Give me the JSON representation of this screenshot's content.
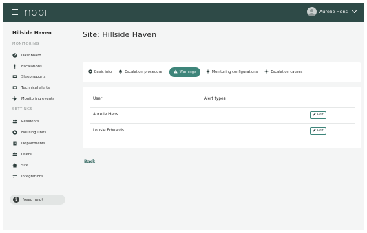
{
  "header": {
    "logo": "nobi",
    "user_name": "Aurelie Hens"
  },
  "sidebar": {
    "site_name": "Hillside Haven",
    "monitoring_label": "MONITORING",
    "settings_label": "SETTINGS",
    "monitoring_items": [
      {
        "label": "Dashboard",
        "icon": "gauge-icon"
      },
      {
        "label": "Escalations",
        "icon": "escalation-icon"
      },
      {
        "label": "Sleep reports",
        "icon": "bed-icon"
      },
      {
        "label": "Technical alerts",
        "icon": "device-icon"
      },
      {
        "label": "Monitoring events",
        "icon": "lamp-icon"
      }
    ],
    "settings_items": [
      {
        "label": "Residents",
        "icon": "residents-icon"
      },
      {
        "label": "Housing units",
        "icon": "housing-icon"
      },
      {
        "label": "Departments",
        "icon": "building-icon"
      },
      {
        "label": "Users",
        "icon": "users-icon"
      },
      {
        "label": "Site",
        "icon": "home-icon"
      },
      {
        "label": "Integrations",
        "icon": "integrations-icon"
      }
    ],
    "help_label": "Need help?"
  },
  "main": {
    "title": "Site: Hillside Haven",
    "tabs": [
      {
        "label": "Basic info",
        "icon": "info-icon",
        "active": false
      },
      {
        "label": "Escalation procedure",
        "icon": "bell-icon",
        "active": false
      },
      {
        "label": "Warnings",
        "icon": "warning-icon",
        "active": true
      },
      {
        "label": "Monitoring configurations",
        "icon": "lamp-icon",
        "active": false
      },
      {
        "label": "Escalation causes",
        "icon": "lamp-icon",
        "active": false
      }
    ],
    "table": {
      "columns": [
        "User",
        "Alert types"
      ],
      "rows": [
        {
          "user": "Aurelie Hens",
          "alert_types": "",
          "action": "Edit"
        },
        {
          "user": "Lousie Edwards",
          "alert_types": "",
          "action": "Edit"
        }
      ]
    },
    "back_label": "Back"
  },
  "colors": {
    "topbar": "#2e4a47",
    "accent": "#3e857a",
    "background": "#f4f5f5"
  }
}
